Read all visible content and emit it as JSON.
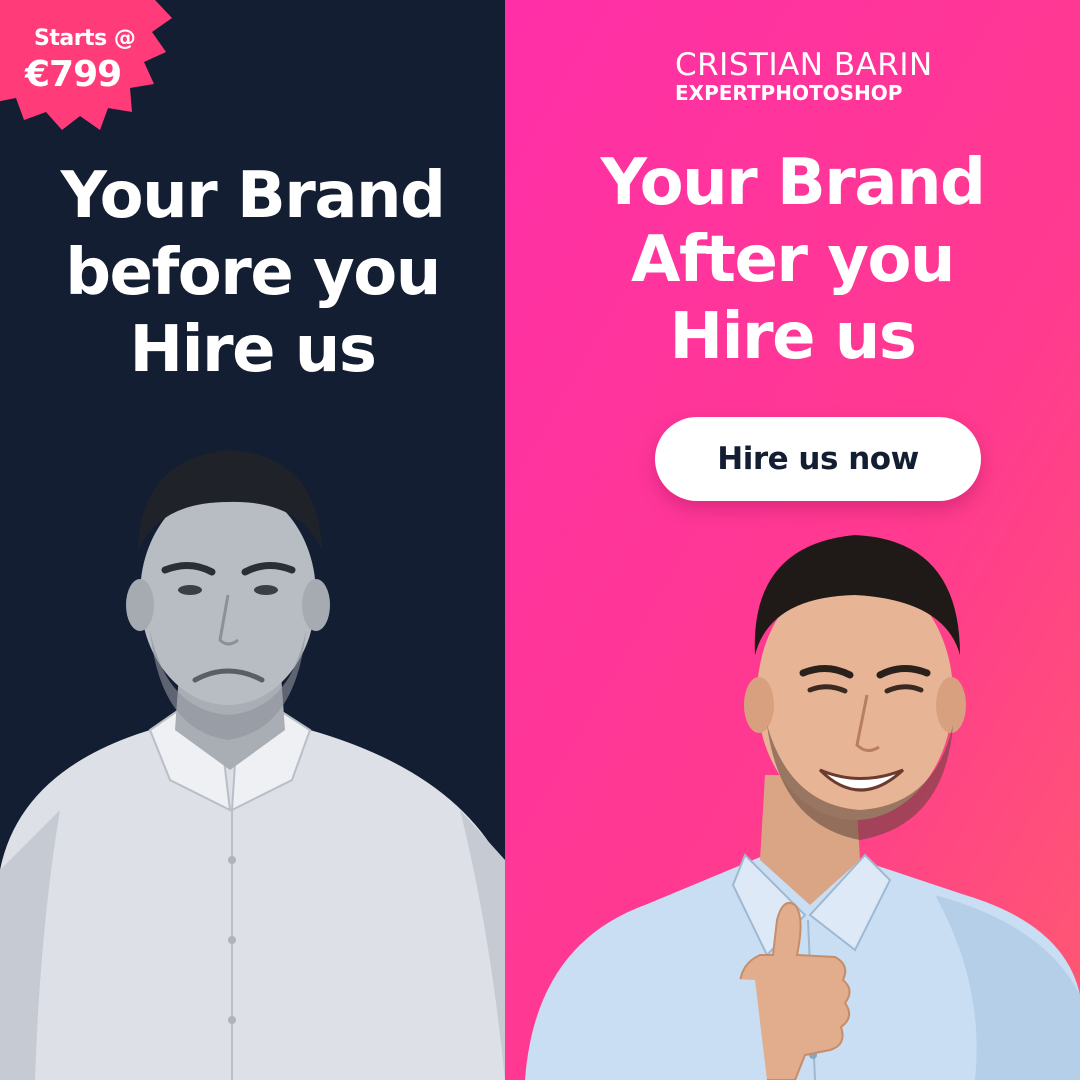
{
  "badge": {
    "line1": "Starts @",
    "line2": "€799",
    "color": "#ff3b7a"
  },
  "left": {
    "headline": [
      "Your Brand",
      "before you",
      "Hire us"
    ],
    "background": "#141e33"
  },
  "right": {
    "logo": {
      "name": "CRISTIAN BARIN",
      "sub": "EXPERTPHOTOSHOP"
    },
    "headline": [
      "Your Brand",
      "After you",
      "Hire us"
    ],
    "cta_label": "Hire us now",
    "gradient": [
      "#ff2fa8",
      "#ff5a70"
    ]
  },
  "people": [
    {
      "side": "left",
      "expression": "unhappy",
      "tone": "black-and-white"
    },
    {
      "side": "right",
      "expression": "smiling-thumbs-up",
      "tone": "color"
    }
  ]
}
